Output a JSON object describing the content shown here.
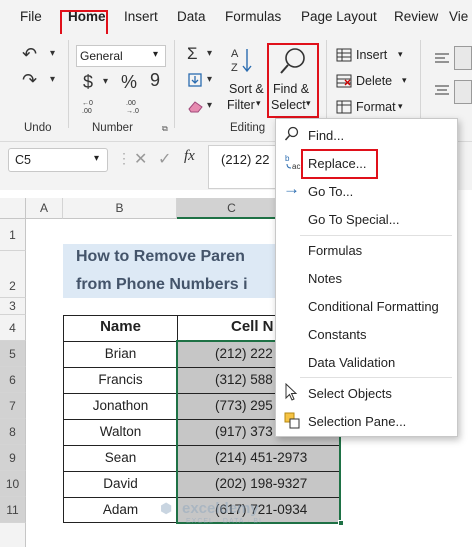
{
  "menu": {
    "items": [
      "File",
      "Home",
      "Insert",
      "Data",
      "Formulas",
      "Page Layout",
      "Review",
      "Vie"
    ]
  },
  "ribbon": {
    "undo_label": "Undo",
    "number_label": "Number",
    "number_format": "General",
    "currency_symbol": "$",
    "percent_symbol": "%",
    "comma_symbol": "9",
    "sort_filter": [
      "Sort &",
      "Filter"
    ],
    "find_select": [
      "Find &",
      "Select"
    ],
    "editing_label": "Editing",
    "insert_label": "Insert",
    "delete_label": "Delete",
    "format_label": "Format"
  },
  "formula_bar": {
    "name_box": "C5",
    "fx": "fx",
    "content": "(212) 22"
  },
  "grid": {
    "columns": [
      "A",
      "B",
      "C"
    ],
    "rows": [
      "1",
      "2",
      "3",
      "4",
      "5",
      "6",
      "7",
      "8",
      "9",
      "10",
      "11"
    ],
    "title_line1": "How to Remove Paren",
    "title_line2": "from Phone Numbers i",
    "headers": [
      "Name",
      "Cell N"
    ],
    "table": [
      {
        "name": "Brian",
        "number": "(212) 222"
      },
      {
        "name": "Francis",
        "number": "(312) 588"
      },
      {
        "name": "Jonathon",
        "number": "(773) 295"
      },
      {
        "name": "Walton",
        "number": "(917) 373"
      },
      {
        "name": "Sean",
        "number": "(214) 451-2973"
      },
      {
        "name": "David",
        "number": "(202) 198-9327"
      },
      {
        "name": "Adam",
        "number": "(617) 721-0934"
      }
    ],
    "watermark": "exceldemy",
    "watermark_sub": "EXCEL · DATA · BI"
  },
  "dropdown": {
    "items": [
      "Find...",
      "Replace...",
      "Go To...",
      "Go To Special...",
      "Formulas",
      "Notes",
      "Conditional Formatting",
      "Constants",
      "Data Validation",
      "Select Objects",
      "Selection Pane..."
    ]
  },
  "colors": {
    "highlight_red": "#e0101a",
    "title_fill": "#dde9f5",
    "title_text": "#44546a",
    "selection_gray": "#c6c6c6",
    "selection_border": "#1e7145"
  }
}
